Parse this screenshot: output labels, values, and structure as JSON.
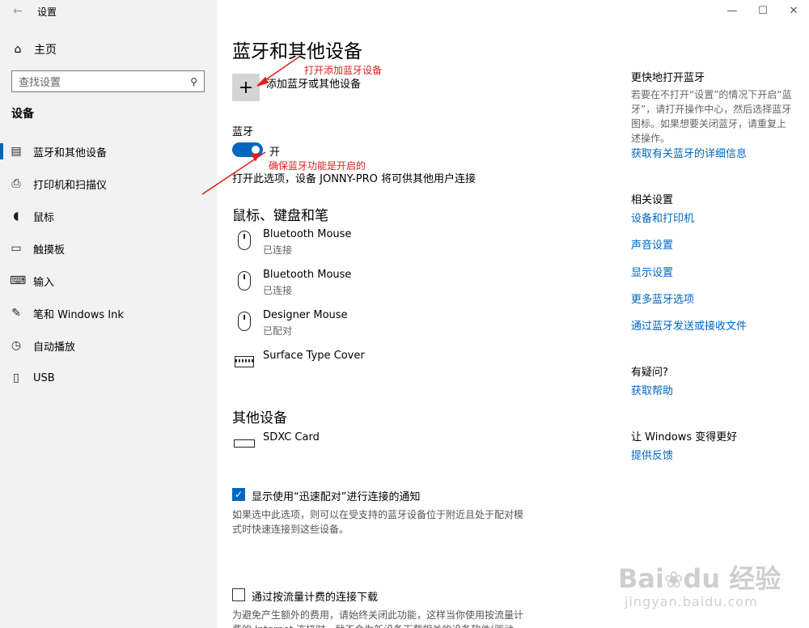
{
  "window": {
    "title": "设置",
    "controls": [
      "—",
      "☐",
      "✕"
    ]
  },
  "sidebar": {
    "back_icon": "←",
    "home_label": "主页",
    "search_placeholder": "查找设置",
    "section": "设备",
    "items": [
      {
        "label": "蓝牙和其他设备",
        "icon": "bluetooth-devices-icon",
        "glyph": "▤",
        "active": true
      },
      {
        "label": "打印机和扫描仪",
        "icon": "printer-icon",
        "glyph": "⎙",
        "active": false
      },
      {
        "label": "鼠标",
        "icon": "mouse-icon",
        "glyph": "◖",
        "active": false
      },
      {
        "label": "触摸板",
        "icon": "touchpad-icon",
        "glyph": "▭",
        "active": false
      },
      {
        "label": "输入",
        "icon": "keyboard-icon",
        "glyph": "⌨",
        "active": false
      },
      {
        "label": "笔和 Windows Ink",
        "icon": "pen-icon",
        "glyph": "✎",
        "active": false
      },
      {
        "label": "自动播放",
        "icon": "autoplay-icon",
        "glyph": "◷",
        "active": false
      },
      {
        "label": "USB",
        "icon": "usb-icon",
        "glyph": "▯",
        "active": false
      }
    ]
  },
  "main": {
    "title": "蓝牙和其他设备",
    "add_device_label": "添加蓝牙或其他设备",
    "bluetooth": {
      "heading": "蓝牙",
      "toggle_on": true,
      "state_label": "开",
      "description": "打开此选项，设备 JONNY-PRO 将可供其他用户连接"
    },
    "peripherals": {
      "heading": "鼠标、键盘和笔",
      "devices": [
        {
          "name": "Bluetooth Mouse",
          "status": "已连接",
          "icon": "mouse-device-icon"
        },
        {
          "name": "Bluetooth Mouse",
          "status": "已连接",
          "icon": "mouse-device-icon"
        },
        {
          "name": "Designer Mouse",
          "status": "已配对",
          "icon": "mouse-device-icon"
        },
        {
          "name": "Surface Type Cover",
          "status": "",
          "icon": "keyboard-device-icon"
        }
      ]
    },
    "other": {
      "heading": "其他设备",
      "devices": [
        {
          "name": "SDXC Card",
          "status": "",
          "icon": "card-device-icon"
        }
      ]
    },
    "swift_pair": {
      "checked": true,
      "label": "显示使用“迅速配对”进行连接的通知",
      "note": "如果选中此选项，则可以在受支持的蓝牙设备位于附近且处于配对模式时快速连接到这些设备。"
    },
    "metered": {
      "checked": false,
      "label": "通过按流量计费的连接下载",
      "note": "为避免产生额外的费用，请始终关闭此功能，这样当你使用按流量计费的 Internet 连接时，就不会为新设备下载相关的设备软件(驱动"
    }
  },
  "right_panel": {
    "quick_heading": "更快地打开蓝牙",
    "quick_text": "若要在不打开“设置”的情况下开启“蓝牙”，请打开操作中心，然后选择蓝牙图标。如果想要关闭蓝牙，请重复上述操作。",
    "quick_link": "获取有关蓝牙的详细信息",
    "related_heading": "相关设置",
    "related_links": [
      "设备和打印机",
      "声音设置",
      "显示设置",
      "更多蓝牙选项",
      "通过蓝牙发送或接收文件"
    ],
    "help_heading": "有疑问?",
    "help_link": "获取帮助",
    "better_heading": "让 Windows 变得更好",
    "feedback_link": "提供反馈"
  },
  "annotations": {
    "add_note": "打开添加蓝牙设备",
    "toggle_note": "确保蓝牙功能是开启的",
    "color": "#e02020"
  },
  "watermark": {
    "logo": "Bai🐾du经验",
    "url": "jingyan.baidu.com"
  },
  "colors": {
    "accent": "#0067c0",
    "sidebar_bg": "#f2f2f2"
  }
}
